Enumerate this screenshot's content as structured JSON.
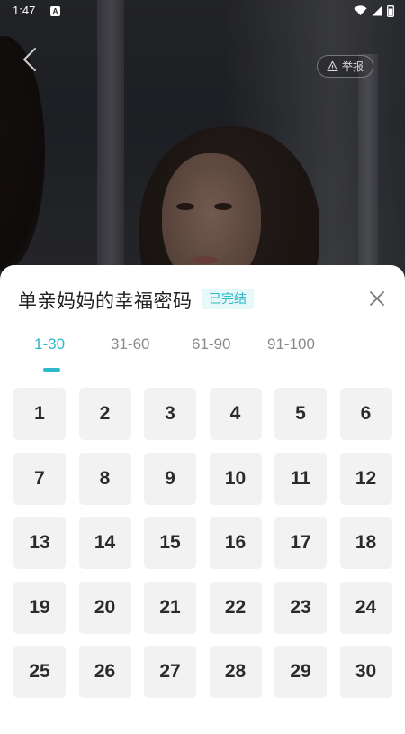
{
  "status_bar": {
    "time": "1:47",
    "notif_glyph": "A"
  },
  "video": {
    "back_icon": "chevron-left-icon"
  },
  "report_button": {
    "label": "举报",
    "icon": "warning-icon"
  },
  "sheet": {
    "title": "单亲妈妈的幸福密码",
    "status_badge": "已完结",
    "close_icon": "close-icon",
    "tabs": [
      {
        "label": "1-30",
        "active": true
      },
      {
        "label": "31-60",
        "active": false
      },
      {
        "label": "61-90",
        "active": false
      },
      {
        "label": "91-100",
        "active": false
      }
    ],
    "episodes": [
      "1",
      "2",
      "3",
      "4",
      "5",
      "6",
      "7",
      "8",
      "9",
      "10",
      "11",
      "12",
      "13",
      "14",
      "15",
      "16",
      "17",
      "18",
      "19",
      "20",
      "21",
      "22",
      "23",
      "24",
      "25",
      "26",
      "27",
      "28",
      "29",
      "30"
    ]
  },
  "colors": {
    "accent": "#2fb8c9",
    "badge_bg": "#e7f8f9",
    "tile_bg": "#f2f2f2"
  }
}
